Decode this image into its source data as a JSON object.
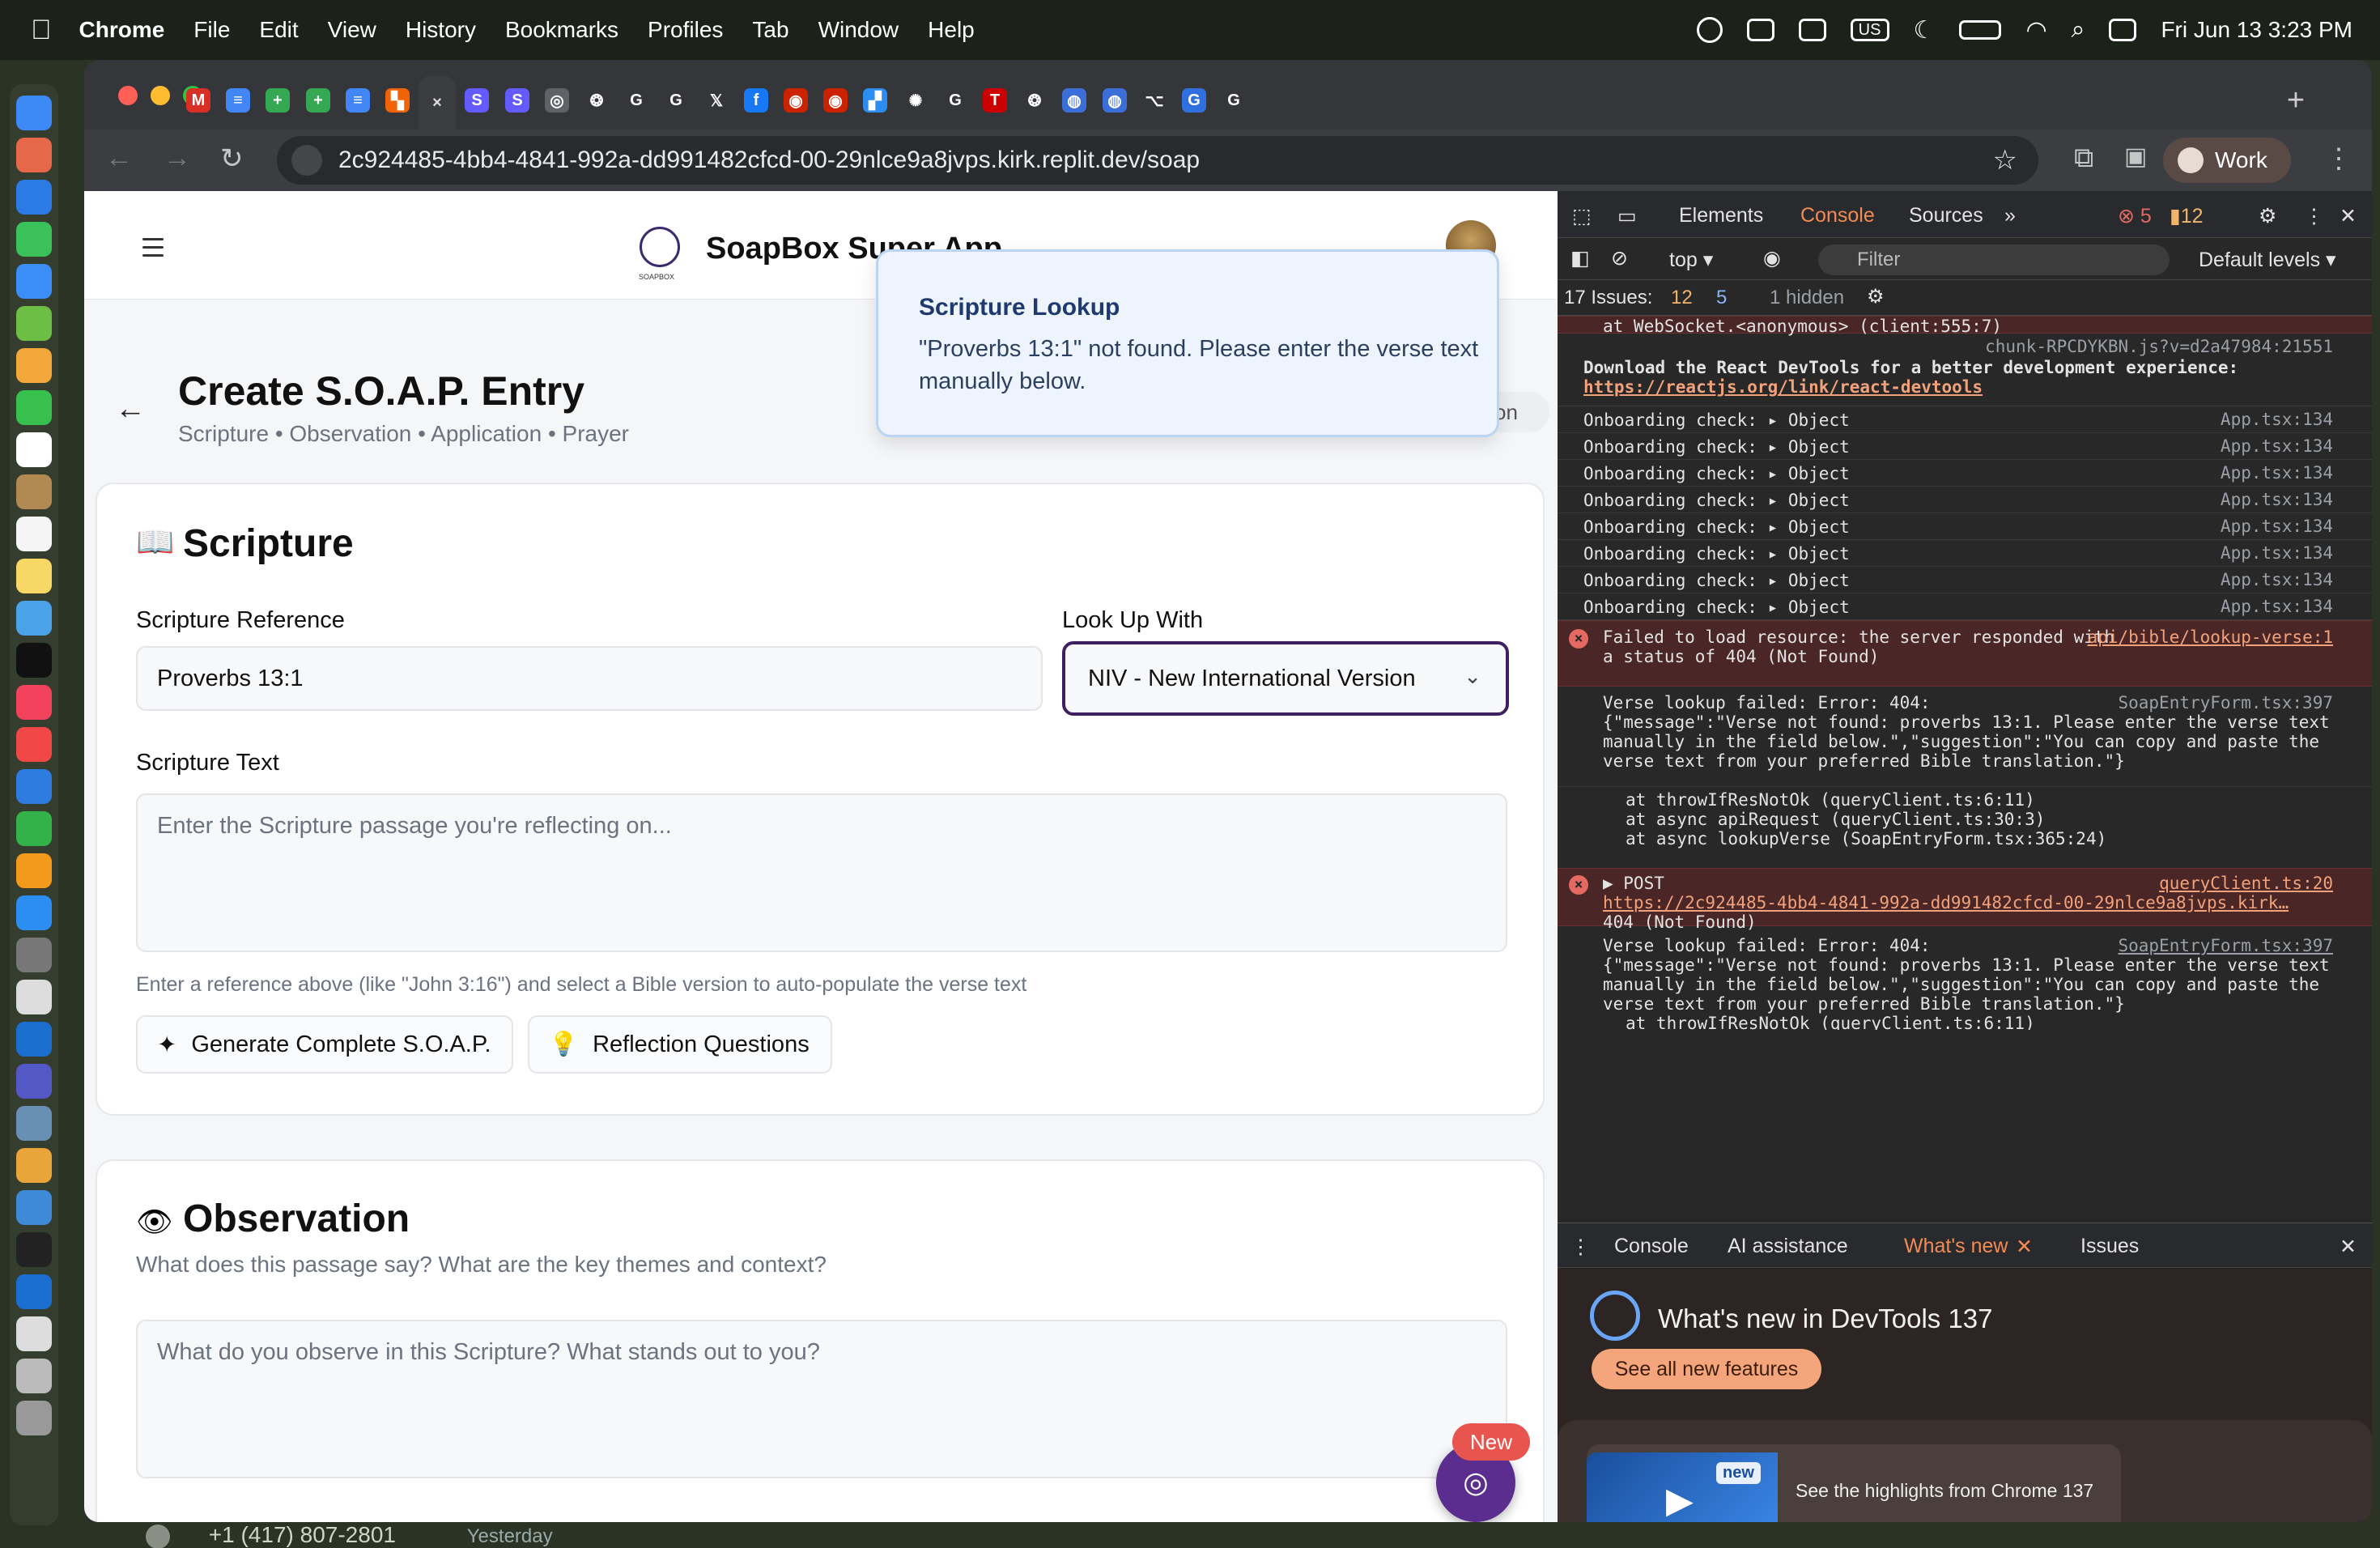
{
  "menubar": {
    "app": "Chrome",
    "items": [
      "File",
      "Edit",
      "View",
      "History",
      "Bookmarks",
      "Profiles",
      "Tab",
      "Window",
      "Help"
    ],
    "input_source": "US",
    "clock": "Fri Jun 13  3:23 PM"
  },
  "browser": {
    "url": "2c924485-4bb4-4841-992a-dd991482cfcd-00-29nlce9a8jvps.kirk.replit.dev/soap",
    "profile": "Work",
    "tabs": [
      {
        "icon": "gmail-icon",
        "color": "#d93025",
        "glyph": "M"
      },
      {
        "icon": "docs-icon",
        "color": "#4285f4",
        "glyph": "≡"
      },
      {
        "icon": "sheets-icon",
        "color": "#34a853",
        "glyph": "+"
      },
      {
        "icon": "sheets-icon",
        "color": "#34a853",
        "glyph": "+"
      },
      {
        "icon": "docs-icon",
        "color": "#4285f4",
        "glyph": "≡"
      },
      {
        "icon": "replit-icon",
        "color": "#f26207",
        "glyph": "▚"
      },
      {
        "icon": "close-icon",
        "color": "#3c3d41",
        "glyph": "×",
        "active": true
      },
      {
        "icon": "stripe-icon",
        "color": "#635bff",
        "glyph": "S"
      },
      {
        "icon": "stripe-icon",
        "color": "#635bff",
        "glyph": "S"
      },
      {
        "icon": "chrome-icon",
        "color": "#5f6368",
        "glyph": "◎"
      },
      {
        "icon": "openai-icon",
        "color": "#35363a",
        "glyph": "❂"
      },
      {
        "icon": "google-icon",
        "color": "#35363a",
        "glyph": "G"
      },
      {
        "icon": "google-icon",
        "color": "#35363a",
        "glyph": "G"
      },
      {
        "icon": "x-icon",
        "color": "#35363a",
        "glyph": "𝕏"
      },
      {
        "icon": "facebook-icon",
        "color": "#1877f2",
        "glyph": "f"
      },
      {
        "icon": "target-icon",
        "color": "#cc2200",
        "glyph": "◉"
      },
      {
        "icon": "target-icon",
        "color": "#cc2200",
        "glyph": "◉"
      },
      {
        "icon": "puzzle-icon",
        "color": "#2d8cf0",
        "glyph": "▞"
      },
      {
        "icon": "perplexity-icon",
        "color": "#35363a",
        "glyph": "✺"
      },
      {
        "icon": "google-icon",
        "color": "#35363a",
        "glyph": "G"
      },
      {
        "icon": "tesla-icon",
        "color": "#cc0000",
        "glyph": "T"
      },
      {
        "icon": "openai-icon",
        "color": "#35363a",
        "glyph": "❂"
      },
      {
        "icon": "globe-icon",
        "color": "#3b6ed6",
        "glyph": "◍"
      },
      {
        "icon": "globe-icon",
        "color": "#3b6ed6",
        "glyph": "◍"
      },
      {
        "icon": "github-icon",
        "color": "#35363a",
        "glyph": "⌥"
      },
      {
        "icon": "g-suite-icon",
        "color": "#2f6fde",
        "glyph": "G"
      },
      {
        "icon": "google-icon",
        "color": "#35363a",
        "glyph": "G"
      }
    ]
  },
  "app": {
    "title": "SoapBox Super App",
    "logo_text": "SOAPBOX",
    "page_title": "Create S.O.A.P. Entry",
    "page_subtitle": "Scripture • Observation • Application • Prayer",
    "pill_text": "on",
    "toast": {
      "title": "Scripture Lookup",
      "message": "\"Proverbs 13:1\" not found. Please enter the verse text manually below."
    },
    "scripture": {
      "heading": "Scripture",
      "ref_label": "Scripture Reference",
      "ref_value": "Proverbs 13:1",
      "lookup_label": "Look Up With",
      "lookup_value": "NIV - New International Version",
      "text_label": "Scripture Text",
      "text_placeholder": "Enter the Scripture passage you're reflecting on...",
      "hint": "Enter a reference above (like \"John 3:16\") and select a Bible version to auto-populate the verse text",
      "btn_generate": "Generate Complete S.O.A.P.",
      "btn_questions": "Reflection Questions"
    },
    "observation": {
      "heading": "Observation",
      "subtitle": "What does this passage say? What are the key themes and context?",
      "placeholder": "What do you observe in this Scripture? What stands out to you?"
    },
    "new_badge": "New",
    "peek_phone": "+1 (417) 807-2801",
    "peek_time": "Yesterday"
  },
  "devtools": {
    "tabs": [
      "Elements",
      "Console",
      "Sources"
    ],
    "active_tab": "Console",
    "error_count": "5",
    "warning_count": "12",
    "context": "top",
    "eye_count": "5",
    "filter_placeholder": "Filter",
    "levels": "Default levels",
    "issues_label": "17 Issues:",
    "issues_warn": "12",
    "issues_info": "5",
    "hidden": "1 hidden",
    "logs": {
      "ws_line": "at WebSocket.<anonymous> (client:555:7)",
      "chunk_src": "chunk-RPCDYKBN.js?v=d2a47984:21551",
      "react_msg": "Download the React DevTools for a better development experience:",
      "react_link": "https://reactjs.org/link/react-devtools",
      "onboarding_label": "Onboarding check:",
      "onboarding_obj": "Object",
      "onboarding_src": "App.tsx:134",
      "err1_msg": "Failed to load resource: the server responded with a status of 404 (Not Found)",
      "err1_src": "api/bible/lookup-verse:1",
      "verse1_head": "Verse lookup failed: Error: 404:",
      "verse1_src": "SoapEntryForm.tsx:397",
      "verse_json": "{\"message\":\"Verse not found: proverbs 13:1. Please enter the verse text manually in the field below.\",\"suggestion\":\"You can copy and paste the verse text from your preferred Bible translation.\"}",
      "stack1": "at throwIfResNotOk (queryClient.ts:6:11)",
      "stack2": "at async apiRequest (queryClient.ts:30:3)",
      "stack3": "at async lookupVerse (SoapEntryForm.tsx:365:24)",
      "post_label": "▶ POST",
      "post_src": "queryClient.ts:20",
      "post_url": "https://2c924485-4bb4-4841-992a-dd991482cfcd-00-29nlce9a8jvps.kirk…",
      "post_status": "404 (Not Found)",
      "verse2_head": "Verse lookup failed: Error: 404:",
      "verse2_src": "SoapEntryForm.tsx:397",
      "stack_cut": "at throwIfResNotOk (queryClient.ts:6:11)"
    },
    "drawer_tabs": [
      "Console",
      "AI assistance",
      "What's new",
      "Issues"
    ],
    "whatsnew_title": "What's new in DevTools 137",
    "see_all": "See all new features",
    "highlight_badge": "new",
    "highlight_text": "See the highlights from Chrome 137"
  }
}
